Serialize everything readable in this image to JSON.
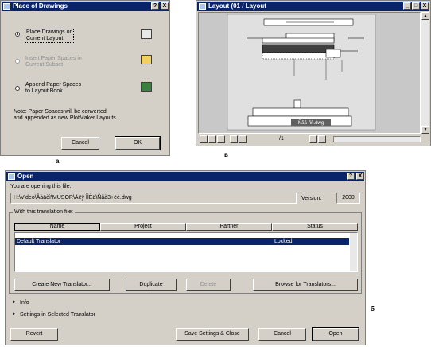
{
  "win_a": {
    "title": "Place of Drawings",
    "help_btn": "?",
    "close_btn": "X",
    "option1_line1": "Place Drawings on",
    "option1_line2": "Current Layout",
    "option2_line1": "Insert Paper Spaces in",
    "option2_line2": "Current Subset",
    "option3_line1": "Append Paper Spaces",
    "option3_line2": "to Layout Book",
    "note_line1": "Note: Paper Spaces will be converted",
    "note_line2": "and appended as new PlotMaker Layouts.",
    "cancel": "Cancel",
    "ok": "OK"
  },
  "win_b": {
    "title": "Layout (01 / Layout",
    "min_btn": "_",
    "max_btn": "□",
    "close_btn": "X",
    "stamp": "Ñãã-ññ.dwg",
    "page_label": "/1",
    "scroll_up": "▲",
    "scroll_down": "▼"
  },
  "win_c": {
    "title": "Open",
    "help_btn": "?",
    "close_btn": "X",
    "opening_label": "You are opening this file:",
    "path": "H:\\Video\\Âàäèì\\MUSOR\\Äëÿ ÎÌÈä\\Ñãà3+ëè.dwg",
    "version_label": "Version:",
    "version_value": "2000",
    "translator_label": "With this translation file:",
    "columns": [
      "Name",
      "Project",
      "Partner",
      "Status"
    ],
    "row_name": "Default Translator",
    "row_status": "Locked",
    "create_btn": "Create New Translator...",
    "duplicate_btn": "Duplicate",
    "delete_btn": "Delete",
    "browse_btn": "Browse for Translators...",
    "info": "Info",
    "settings": "Settings in Selected Translator",
    "revert": "Revert",
    "save_close": "Save Settings & Close",
    "cancel": "Cancel",
    "open": "Open"
  },
  "captions": {
    "a": "a",
    "b": "в",
    "c": "б"
  }
}
